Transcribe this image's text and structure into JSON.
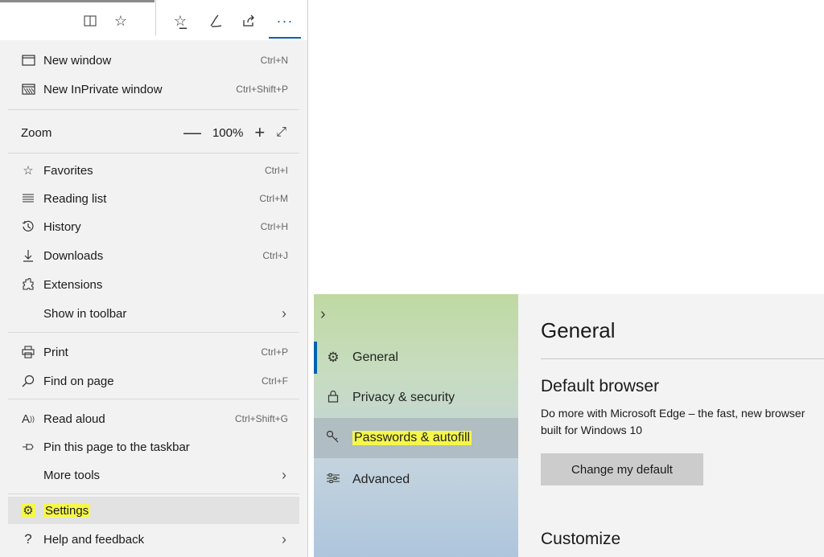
{
  "toolbar": {
    "icons": [
      "reading-view-icon",
      "favorite-star-icon",
      "favorites-list-icon",
      "pen-icon",
      "share-icon",
      "more-icon"
    ],
    "more_label": "···"
  },
  "menu": {
    "new_window": {
      "label": "New window",
      "shortcut": "Ctrl+N"
    },
    "new_inprivate": {
      "label": "New InPrivate window",
      "shortcut": "Ctrl+Shift+P"
    },
    "zoom": {
      "label": "Zoom",
      "value": "100%",
      "minus": "—",
      "plus": "+"
    },
    "favorites": {
      "label": "Favorites",
      "shortcut": "Ctrl+I"
    },
    "reading_list": {
      "label": "Reading list",
      "shortcut": "Ctrl+M"
    },
    "history": {
      "label": "History",
      "shortcut": "Ctrl+H"
    },
    "downloads": {
      "label": "Downloads",
      "shortcut": "Ctrl+J"
    },
    "extensions": {
      "label": "Extensions"
    },
    "show_in_toolbar": {
      "label": "Show in toolbar"
    },
    "print": {
      "label": "Print",
      "shortcut": "Ctrl+P"
    },
    "find_on_page": {
      "label": "Find on page",
      "shortcut": "Ctrl+F"
    },
    "read_aloud": {
      "label": "Read aloud",
      "shortcut": "Ctrl+Shift+G"
    },
    "pin_taskbar": {
      "label": "Pin this page to the taskbar"
    },
    "more_tools": {
      "label": "More tools"
    },
    "settings": {
      "label": "Settings"
    },
    "help": {
      "label": "Help and feedback"
    }
  },
  "settings_nav": {
    "items": [
      {
        "label": "General",
        "icon": "gear-icon"
      },
      {
        "label": "Privacy & security",
        "icon": "lock-icon"
      },
      {
        "label": "Passwords & autofill",
        "icon": "key-icon"
      },
      {
        "label": "Advanced",
        "icon": "sliders-icon"
      }
    ]
  },
  "settings_content": {
    "page_title": "General",
    "default_browser_title": "Default browser",
    "default_browser_desc": "Do more with Microsoft Edge – the fast, new browser built for Windows 10",
    "change_default_button": "Change my default",
    "customize_title": "Customize"
  },
  "colors": {
    "accent": "#0063b1",
    "highlight": "#f6f74a"
  }
}
